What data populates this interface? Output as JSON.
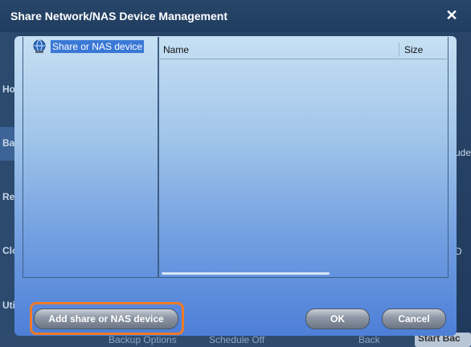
{
  "background": {
    "sidebar_labels": [
      "Ho",
      "Ba",
      "Re",
      "Clo",
      "Uti"
    ],
    "right_labels": [
      "ude",
      "D"
    ],
    "bottom_items": [
      "Backup Options",
      "Schedule Off",
      "Back",
      "Start Bac"
    ]
  },
  "dialog": {
    "title": "Share Network/NAS Device Management",
    "close_glyph": "✕",
    "tree": {
      "items": [
        {
          "label": "Share or NAS device",
          "icon": "network-globe-icon"
        }
      ]
    },
    "list": {
      "columns": [
        "Name",
        "Size"
      ],
      "rows": []
    },
    "buttons": {
      "add_label": "Add share or NAS device",
      "ok_label": "OK",
      "cancel_label": "Cancel"
    },
    "colors": {
      "highlight": "#f07a28",
      "selection": "#3a78d6"
    }
  }
}
